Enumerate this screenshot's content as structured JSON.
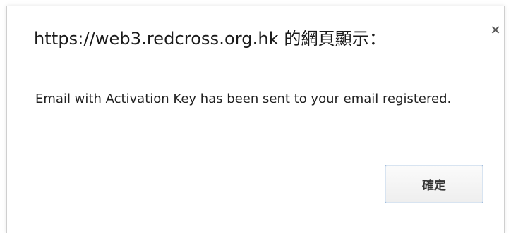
{
  "dialog": {
    "title": "https://web3.redcross.org.hk 的網頁顯示：",
    "close_icon": "close-icon",
    "close_symbol": "×",
    "message": "Email with Activation Key has been sent to your email registered.",
    "ok_label": "確定"
  },
  "colors": {
    "button_border": "#7da2ce",
    "dialog_border": "#cfcfcf"
  }
}
